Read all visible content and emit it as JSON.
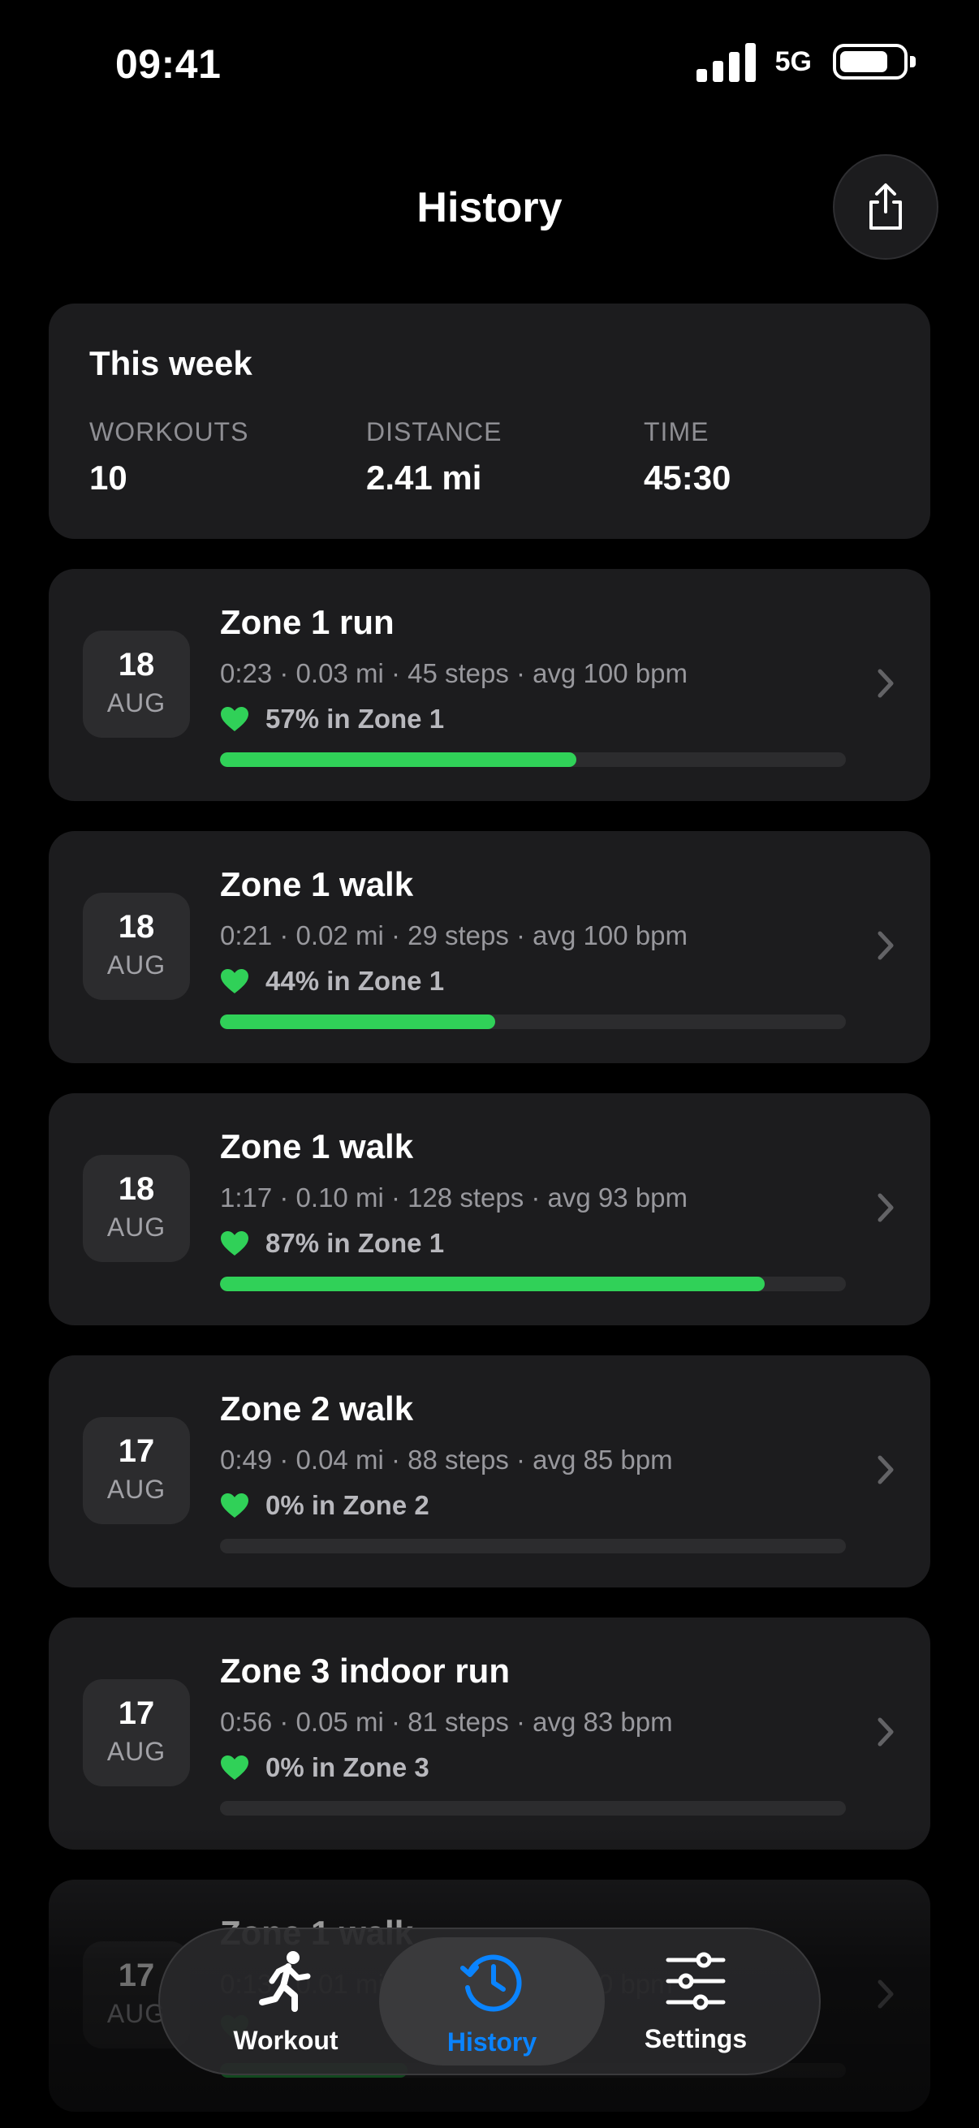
{
  "status_bar": {
    "time": "09:41",
    "network": "5G"
  },
  "header": {
    "title": "History"
  },
  "summary": {
    "title": "This week",
    "stats": [
      {
        "label": "WORKOUTS",
        "value": "10"
      },
      {
        "label": "DISTANCE",
        "value": "2.41 mi"
      },
      {
        "label": "TIME",
        "value": "45:30"
      }
    ]
  },
  "workouts": [
    {
      "day": "18",
      "month": "AUG",
      "title": "Zone 1 run",
      "meta": "0:23 · 0.03 mi · 45 steps · avg 100 bpm",
      "zone_text": "57% in Zone 1",
      "zone_percent": 57
    },
    {
      "day": "18",
      "month": "AUG",
      "title": "Zone 1 walk",
      "meta": "0:21 · 0.02 mi · 29 steps · avg 100 bpm",
      "zone_text": "44% in Zone 1",
      "zone_percent": 44
    },
    {
      "day": "18",
      "month": "AUG",
      "title": "Zone 1 walk",
      "meta": "1:17 · 0.10 mi · 128 steps · avg 93 bpm",
      "zone_text": "87% in Zone 1",
      "zone_percent": 87
    },
    {
      "day": "17",
      "month": "AUG",
      "title": "Zone 2 walk",
      "meta": "0:49 · 0.04 mi · 88 steps · avg 85 bpm",
      "zone_text": "0% in Zone 2",
      "zone_percent": 0
    },
    {
      "day": "17",
      "month": "AUG",
      "title": "Zone 3 indoor run",
      "meta": "0:56 · 0.05 mi · 81 steps · avg 83 bpm",
      "zone_text": "0% in Zone 3",
      "zone_percent": 0
    },
    {
      "day": "17",
      "month": "AUG",
      "title": "Zone 1 walk",
      "meta": "0:13 · 0.01 mi · 20 steps · avg 90 bpm",
      "zone_text": "",
      "zone_percent": 30
    }
  ],
  "tab_bar": {
    "tabs": [
      {
        "label": "Workout",
        "icon": "running-figure-icon"
      },
      {
        "label": "History",
        "icon": "clock-history-icon",
        "active": true
      },
      {
        "label": "Settings",
        "icon": "sliders-icon"
      }
    ]
  },
  "colors": {
    "accent": "#30d158",
    "active_tab": "#0a84ff",
    "card": "#1c1c1e"
  }
}
